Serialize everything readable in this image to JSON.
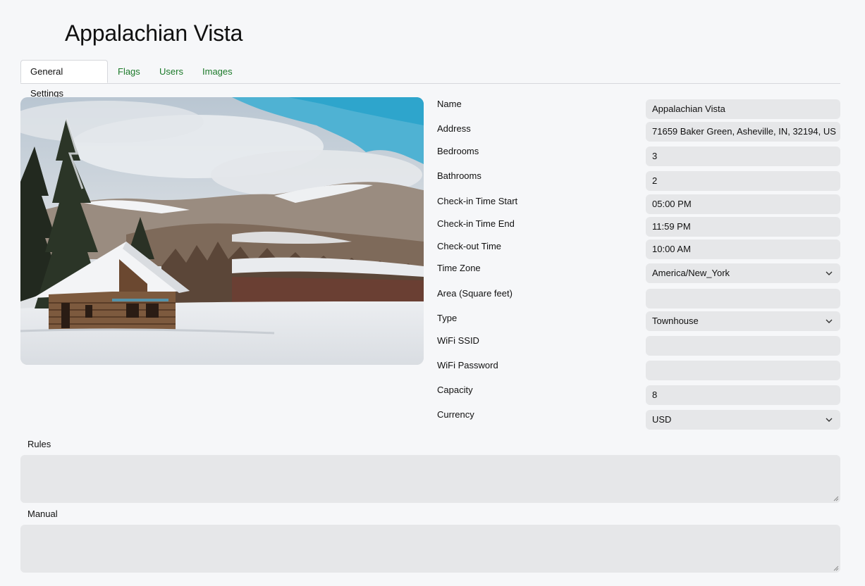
{
  "page": {
    "title": "Appalachian Vista"
  },
  "tabs": [
    {
      "label": "General Settings",
      "active": true
    },
    {
      "label": "Flags",
      "active": false
    },
    {
      "label": "Users",
      "active": false
    },
    {
      "label": "Images",
      "active": false
    }
  ],
  "form": {
    "name": {
      "label": "Name",
      "value": "Appalachian Vista"
    },
    "address": {
      "label": "Address",
      "value": "71659 Baker Green, Asheville, IN, 32194, US"
    },
    "bedrooms": {
      "label": "Bedrooms",
      "value": "3"
    },
    "bathrooms": {
      "label": "Bathrooms",
      "value": "2"
    },
    "checkin_start": {
      "label": "Check-in Time Start",
      "value": "05:00 PM"
    },
    "checkin_end": {
      "label": "Check-in Time End",
      "value": "11:59 PM"
    },
    "checkout": {
      "label": "Check-out Time",
      "value": "10:00 AM"
    },
    "timezone": {
      "label": "Time Zone",
      "value": "America/New_York"
    },
    "area": {
      "label": "Area (Square feet)",
      "value": ""
    },
    "type": {
      "label": "Type",
      "value": "Townhouse"
    },
    "wifi_ssid": {
      "label": "WiFi SSID",
      "value": ""
    },
    "wifi_password": {
      "label": "WiFi Password",
      "value": ""
    },
    "capacity": {
      "label": "Capacity",
      "value": "8"
    },
    "currency": {
      "label": "Currency",
      "value": "USD"
    }
  },
  "rules": {
    "label": "Rules",
    "value": ""
  },
  "manual": {
    "label": "Manual",
    "value": ""
  },
  "colors": {
    "tab_link": "#1c7a2a",
    "field_bg": "#e6e7e9",
    "page_bg": "#f6f7f9"
  }
}
